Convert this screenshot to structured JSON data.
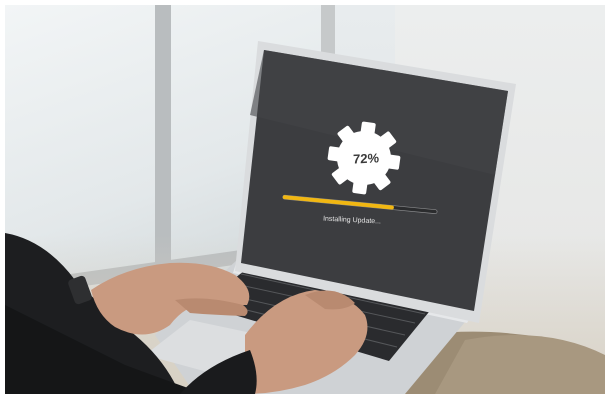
{
  "update": {
    "progress_text": "72%",
    "progress": 0.72,
    "status": "Installing Update..."
  },
  "colors": {
    "screen": "#3c3d40",
    "progress_fill": "#f1b712",
    "gear": "#ffffff",
    "laptop_body": "#d8dadc"
  },
  "icons": [
    "gear-icon"
  ]
}
